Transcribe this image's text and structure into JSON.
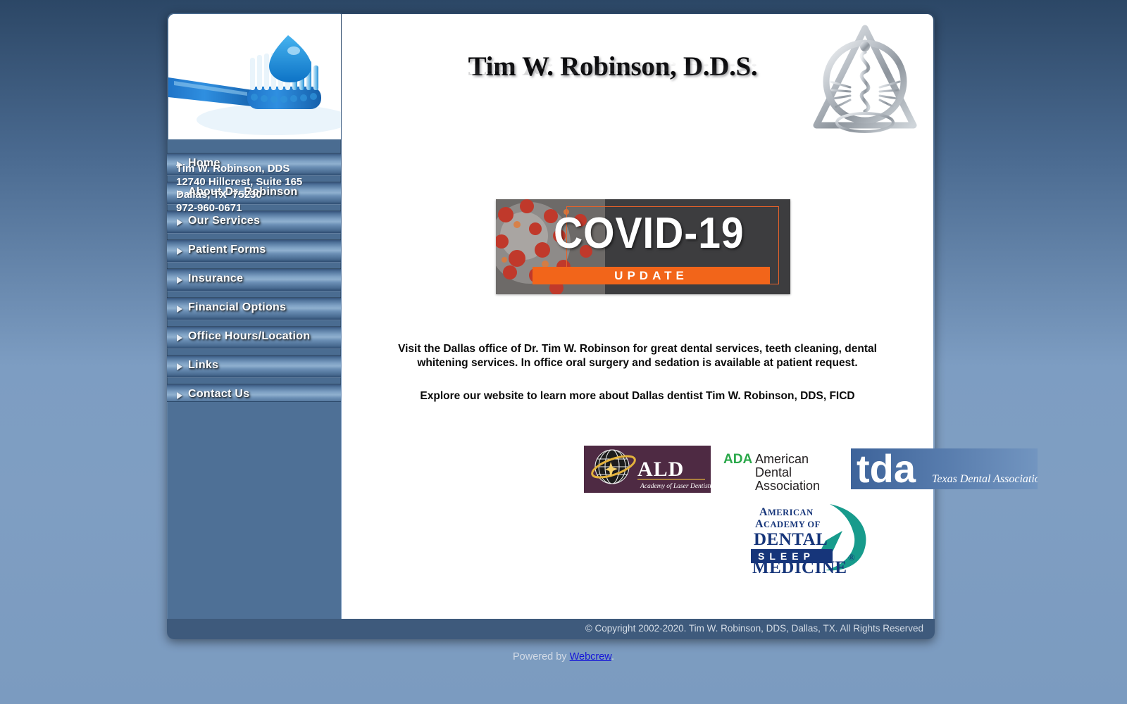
{
  "site": {
    "header": {
      "title": "Tim W. Robinson, D.D.S.",
      "emblem_icon": "dental-caduceus-emblem",
      "photo_icon": "toothbrush-photo"
    },
    "sidebar": {
      "menu": [
        {
          "label": "Home",
          "bullet_icon": "triangle-bullet-icon"
        },
        {
          "label": "About Dr. Robinson",
          "bullet_icon": "triangle-bullet-icon"
        },
        {
          "label": "Our Services",
          "bullet_icon": "triangle-bullet-icon"
        },
        {
          "label": "Patient Forms",
          "bullet_icon": "triangle-bullet-icon"
        },
        {
          "label": "Insurance",
          "bullet_icon": "triangle-bullet-icon"
        },
        {
          "label": "Financial Options",
          "bullet_icon": "triangle-bullet-icon"
        },
        {
          "label": "Office Hours/Location",
          "bullet_icon": "triangle-bullet-icon"
        },
        {
          "label": "Links",
          "bullet_icon": "triangle-bullet-icon"
        },
        {
          "label": "Contact Us",
          "bullet_icon": "triangle-bullet-icon"
        }
      ],
      "address": {
        "name": "Tim W. Robinson, DDS",
        "street": "12740 Hillcrest, Suite 165",
        "city_state_zip": "Dallas, TX  75230",
        "phone": "972-960-0671"
      }
    },
    "main": {
      "covid_banner": {
        "title": "COVID-19",
        "subtitle": "UPDATE",
        "accent_color": "#f2651a",
        "background_color": "#3d3d3f"
      },
      "intro_paragraph": "Visit the Dallas office of Dr. Tim W. Robinson for great dental services, teeth cleaning, dental whitening services.  In office oral surgery and sedation is available at patient request.",
      "explore_paragraph": "Explore our website to learn more about Dallas dentist Tim W. Robinson, DDS, FICD",
      "logos": {
        "ald": {
          "abbr": "ALD",
          "full": "Academy of Laser Dentistry",
          "background_color": "#4e2a43"
        },
        "ada": {
          "abbr": "ADA",
          "line1": "American",
          "line2": "Dental",
          "line3": "Association",
          "abbr_color": "#2aa84a"
        },
        "tda": {
          "abbr": "tda",
          "full": "Texas Dental Association",
          "background_color": "#41679b"
        },
        "aadsm": {
          "line1": "AMERICAN",
          "line2": "ACADEMY OF",
          "line3": "DENTAL",
          "line4": "SLEEP",
          "line5": "MEDICINE",
          "registered_mark": "®",
          "text_color": "#16357a",
          "accent_color": "#1a9e8f"
        }
      }
    },
    "footer": {
      "copyright": "© Copyright 2002-2020. Tim W. Robinson, DDS, Dallas, TX.  All Rights Reserved",
      "powered_by_prefix": "Powered by ",
      "powered_by_link": "Webcrew",
      "powered_by_suffix": "."
    }
  }
}
